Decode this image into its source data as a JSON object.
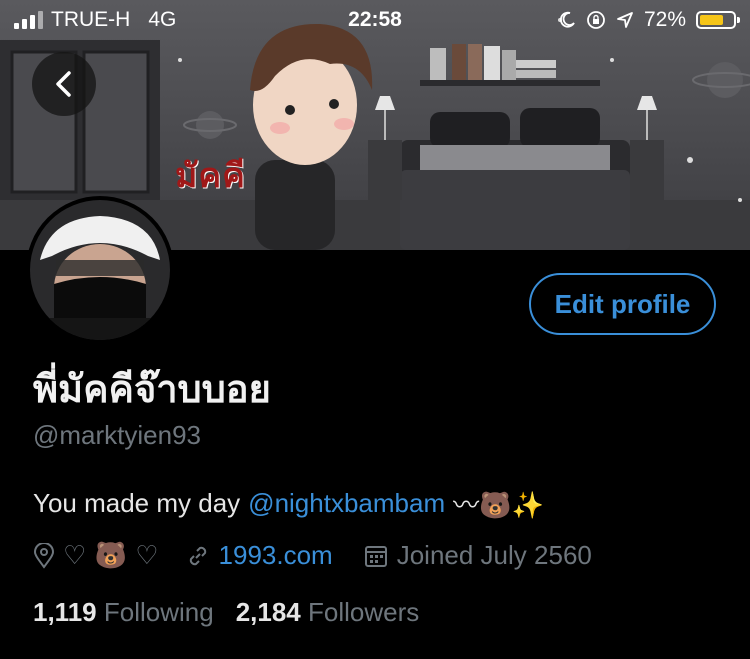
{
  "status_bar": {
    "carrier": "TRUE-H",
    "network": "4G",
    "time": "22:58",
    "battery_percent_text": "72%",
    "battery_level": 0.72
  },
  "banner": {
    "caption": "มัคคี"
  },
  "profile": {
    "edit_button_label": "Edit profile",
    "display_name": "พี่มัคคีจ๊าบบอย",
    "handle": "@marktyien93",
    "bio_text": "You made my day",
    "bio_mention": "@nightxbambam",
    "bio_emoji": "〰🐻✨",
    "location": "♡ 🐻 ♡",
    "website": "1993.com",
    "joined": "Joined July 2560",
    "following_count": "1,119",
    "following_label": "Following",
    "followers_count": "2,184",
    "followers_label": "Followers"
  },
  "colors": {
    "accent": "#3a8fd9",
    "muted": "#6e767d",
    "background": "#000000",
    "battery": "#f5c518"
  }
}
